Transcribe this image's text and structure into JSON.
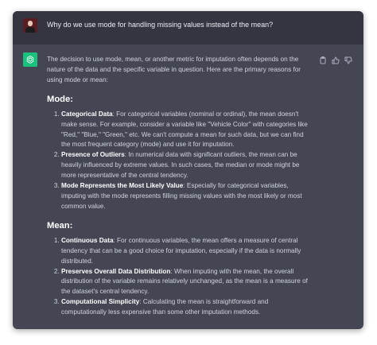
{
  "user": {
    "question": "Why do we use mode for handling missing values instead of the mean?"
  },
  "assistant": {
    "intro": "The decision to use mode, mean, or another metric for imputation often depends on the nature of the data and the specific variable in question. Here are the primary reasons for using mode or mean:",
    "sections": [
      {
        "heading": "Mode:",
        "items": [
          {
            "title": "Categorical Data",
            "text": ": For categorical variables (nominal or ordinal), the mean doesn't make sense. For example, consider a variable like \"Vehicle Color\" with categories like \"Red,\" \"Blue,\" \"Green,\" etc. We can't compute a mean for such data, but we can find the most frequent category (mode) and use it for imputation."
          },
          {
            "title": "Presence of Outliers",
            "text": ": In numerical data with significant outliers, the mean can be heavily influenced by extreme values. In such cases, the median or mode might be more representative of the central tendency."
          },
          {
            "title": "Mode Represents the Most Likely Value",
            "text": ": Especially for categorical variables, imputing with the mode represents filling missing values with the most likely or most common value."
          }
        ]
      },
      {
        "heading": "Mean:",
        "items": [
          {
            "title": "Continuous Data",
            "text": ": For continuous variables, the mean offers a measure of central tendency that can be a good choice for imputation, especially if the data is normally distributed."
          },
          {
            "title": "Preserves Overall Data Distribution",
            "text": ": When imputing with the mean, the overall distribution of the variable remains relatively unchanged, as the mean is a measure of the dataset's central tendency."
          },
          {
            "title": "Computational Simplicity",
            "text": ": Calculating the mean is straightforward and computationally less expensive than some other imputation methods."
          }
        ]
      }
    ]
  },
  "actions": {
    "icons": [
      "copy-icon",
      "thumbs-up-icon",
      "thumbs-down-icon"
    ]
  },
  "colors": {
    "user_bg": "#343541",
    "assistant_bg": "#444654",
    "bot_avatar": "#19c37d",
    "text": "#d1d5db"
  }
}
